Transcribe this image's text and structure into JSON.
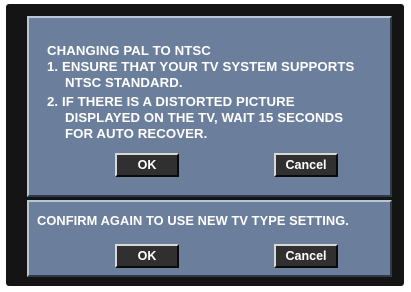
{
  "main_dialog": {
    "lines": [
      "CHANGING PAL TO NTSC",
      "1. ENSURE THAT YOUR TV SYSTEM SUPPORTS",
      "NTSC STANDARD.",
      "2. IF THERE IS A DISTORTED PICTURE",
      "DISPLAYED ON THE TV, WAIT 15 SECONDS",
      "FOR AUTO RECOVER."
    ],
    "ok_label": "OK",
    "cancel_label": "Cancel"
  },
  "confirm_dialog": {
    "message": "CONFIRM AGAIN TO USE NEW TV TYPE SETTING.",
    "ok_label": "OK",
    "cancel_label": "Cancel"
  },
  "colors": {
    "screen_background": "#141414",
    "dialog_background": "#6b7f9c",
    "button_background": "#303030",
    "text": "#ffffff"
  }
}
